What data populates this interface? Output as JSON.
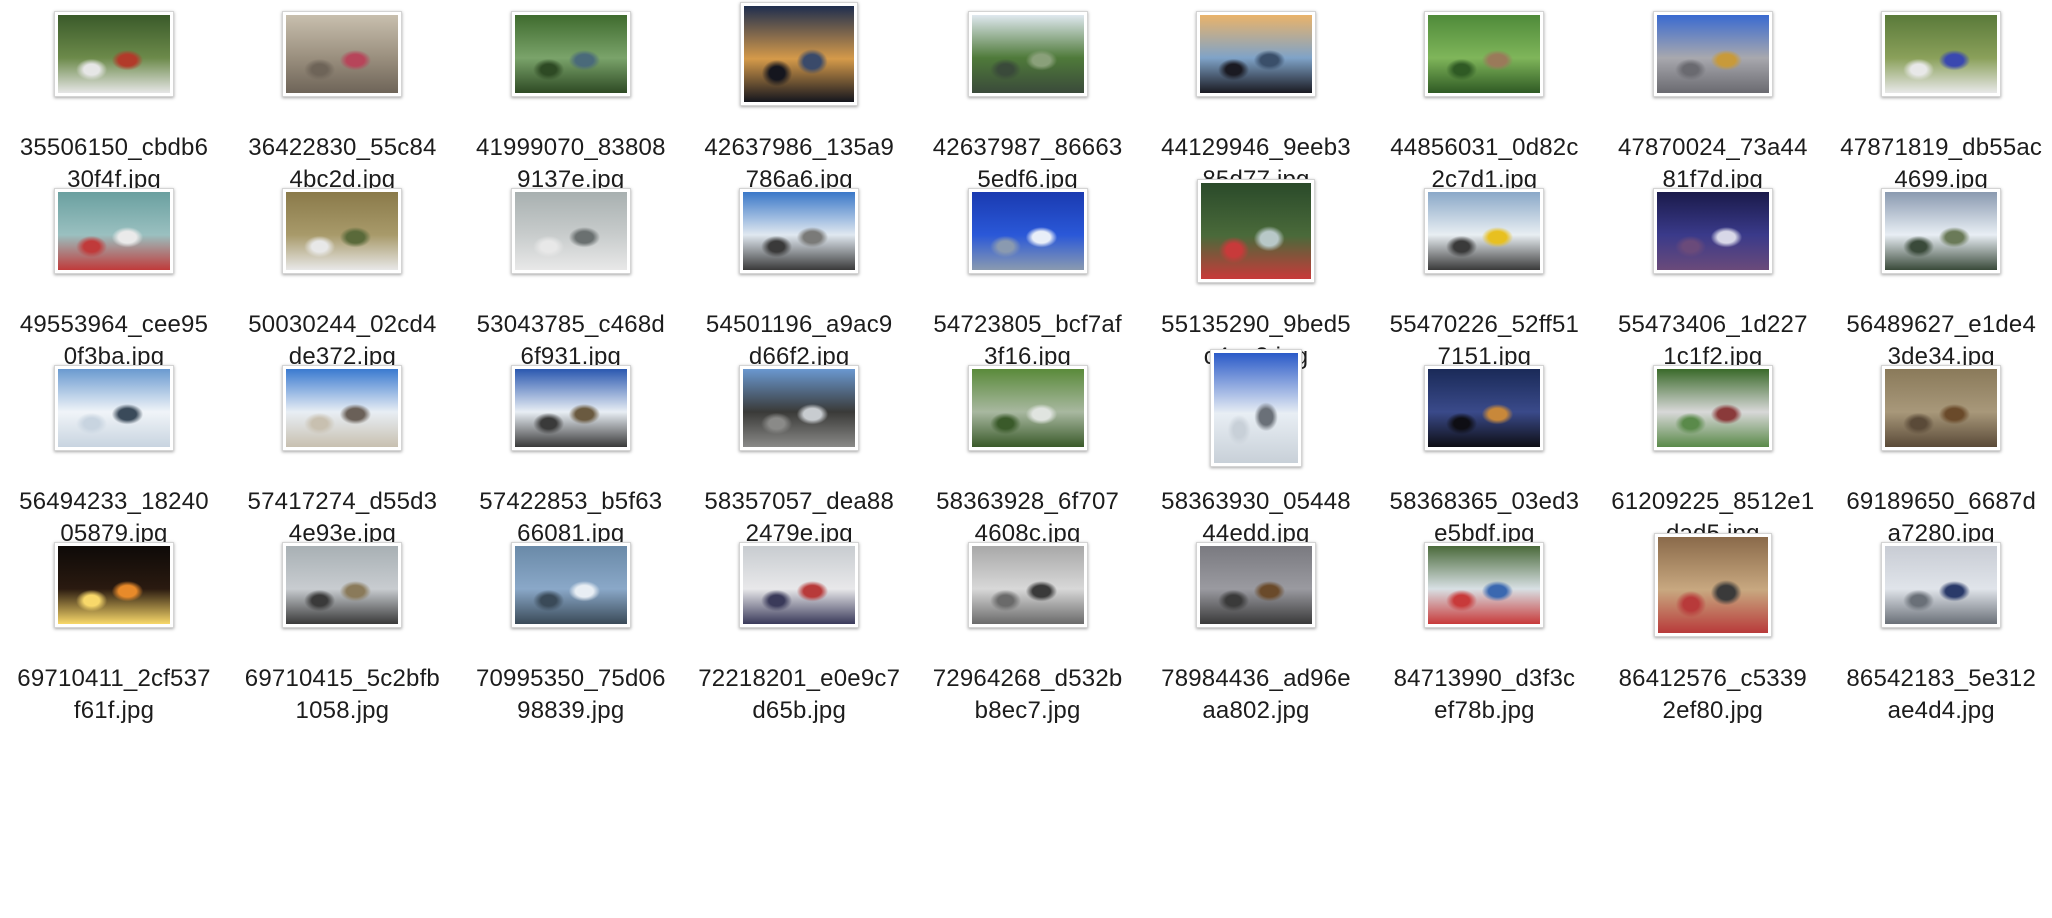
{
  "files": [
    {
      "line1": "35506150_cbdb6",
      "line2": "30f4f.jpg",
      "shape": "land",
      "colors": [
        "#3a5a2a",
        "#6c8a4a",
        "#b23a2a",
        "#e6e6e6"
      ]
    },
    {
      "line1": "36422830_55c84",
      "line2": "4bc2d.jpg",
      "shape": "land",
      "colors": [
        "#c8bfae",
        "#9a8f7e",
        "#b7455a",
        "#6e6458"
      ]
    },
    {
      "line1": "41999070_83808",
      "line2": "9137e.jpg",
      "shape": "land",
      "colors": [
        "#3f6b2e",
        "#7aa36a",
        "#4a6a7a",
        "#2e4a24"
      ]
    },
    {
      "line1": "42637986_135a9",
      "line2": "786a6.jpg",
      "shape": "tall",
      "colors": [
        "#1f2e4e",
        "#d59a4a",
        "#3a4a6a",
        "#15161e"
      ]
    },
    {
      "line1": "42637987_86663",
      "line2": "5edf6.jpg",
      "shape": "land",
      "colors": [
        "#dfe8ef",
        "#4f7a3a",
        "#8aa07a",
        "#3a4a3a"
      ]
    },
    {
      "line1": "44129946_9eeb3",
      "line2": "85d77.jpg",
      "shape": "land",
      "colors": [
        "#e9b36a",
        "#7fa3c8",
        "#3a4f6a",
        "#1a1a22"
      ]
    },
    {
      "line1": "44856031_0d82c",
      "line2": "2c7d1.jpg",
      "shape": "land",
      "colors": [
        "#4f8a3a",
        "#7fb55a",
        "#9a7a5a",
        "#2f5a24"
      ]
    },
    {
      "line1": "47870024_73a44",
      "line2": "81f7d.jpg",
      "shape": "land",
      "colors": [
        "#3a6ad0",
        "#a8a8ae",
        "#c89a3a",
        "#6a6a70"
      ]
    },
    {
      "line1": "47871819_db55ac",
      "line2": "4699.jpg",
      "shape": "land",
      "colors": [
        "#5a7a3a",
        "#8aa05a",
        "#3a48b0",
        "#e8e8e8"
      ]
    },
    {
      "line1": "49553964_cee95",
      "line2": "0f3ba.jpg",
      "shape": "land",
      "colors": [
        "#6aa0a0",
        "#9ac0c0",
        "#eaeaea",
        "#c03a3a"
      ]
    },
    {
      "line1": "50030244_02cd4",
      "line2": "de372.jpg",
      "shape": "land",
      "colors": [
        "#8a7a4a",
        "#a89a6a",
        "#5a6a3a",
        "#e8e8e8"
      ]
    },
    {
      "line1": "53043785_c468d",
      "line2": "6f931.jpg",
      "shape": "land",
      "colors": [
        "#a8b0b0",
        "#c8cccc",
        "#6a7070",
        "#e8e8e8"
      ]
    },
    {
      "line1": "54501196_a9ac9",
      "line2": "d66f2.jpg",
      "shape": "land",
      "colors": [
        "#3a78c8",
        "#e0e8f0",
        "#7a7a78",
        "#3a3a3a"
      ]
    },
    {
      "line1": "54723805_bcf7af",
      "line2": "3f16.jpg",
      "shape": "land",
      "colors": [
        "#1a3ab0",
        "#2a58d8",
        "#e8eef8",
        "#8a9ab0"
      ]
    },
    {
      "line1": "55135290_9bed5",
      "line2": "c4ca3.jpg",
      "shape": "tall",
      "colors": [
        "#2a4a2a",
        "#4a6a3a",
        "#b8c8c8",
        "#c83a3a"
      ]
    },
    {
      "line1": "55470226_52ff51",
      "line2": "7151.jpg",
      "shape": "land",
      "colors": [
        "#8aa8c8",
        "#e8eef2",
        "#e8c020",
        "#3a3a3a"
      ]
    },
    {
      "line1": "55473406_1d227",
      "line2": "1c1f2.jpg",
      "shape": "land",
      "colors": [
        "#1a1a4a",
        "#3a3a8a",
        "#d8d8e8",
        "#6a4a7a"
      ]
    },
    {
      "line1": "56489627_e1de4",
      "line2": "3de34.jpg",
      "shape": "land",
      "colors": [
        "#8a9ab0",
        "#e8eef4",
        "#6a7a58",
        "#3a4a3a"
      ]
    },
    {
      "line1": "56494233_18240",
      "line2": "05879.jpg",
      "shape": "land",
      "colors": [
        "#6a9ad0",
        "#f0f4f8",
        "#3a4a5a",
        "#c8d4e0"
      ]
    },
    {
      "line1": "57417274_d55d3",
      "line2": "4e93e.jpg",
      "shape": "land",
      "colors": [
        "#3a7ad0",
        "#e8eef4",
        "#6a6058",
        "#c8c0b0"
      ]
    },
    {
      "line1": "57422853_b5f63",
      "line2": "66081.jpg",
      "shape": "land",
      "colors": [
        "#2a58b0",
        "#e8eef4",
        "#6a5a40",
        "#3a3a3a"
      ]
    },
    {
      "line1": "58357057_dea88",
      "line2": "2479e.jpg",
      "shape": "land",
      "colors": [
        "#6a98d0",
        "#3a3a38",
        "#c8ccd0",
        "#8a8a88"
      ]
    },
    {
      "line1": "58363928_6f707",
      "line2": "4608c.jpg",
      "shape": "land",
      "colors": [
        "#5a8a3a",
        "#a8b8a0",
        "#e0e4e0",
        "#3a5a2a"
      ]
    },
    {
      "line1": "58363930_05448",
      "line2": "44edd.jpg",
      "shape": "port",
      "colors": [
        "#2a5ac8",
        "#e8eef4",
        "#6a7078",
        "#c8d0d8"
      ]
    },
    {
      "line1": "58368365_03ed3",
      "line2": "e5bdf.jpg",
      "shape": "land",
      "colors": [
        "#1a2a58",
        "#3a4a8a",
        "#c8883a",
        "#0e0e14"
      ]
    },
    {
      "line1": "61209225_8512e1",
      "line2": "dad5.jpg",
      "shape": "land",
      "colors": [
        "#3a6a2a",
        "#d8d8d8",
        "#8a3a3a",
        "#5a8a4a"
      ]
    },
    {
      "line1": "69189650_6687d",
      "line2": "a7280.jpg",
      "shape": "land",
      "colors": [
        "#8a7a5a",
        "#a8987a",
        "#6a4a2a",
        "#5a4a38"
      ]
    },
    {
      "line1": "69710411_2cf537",
      "line2": "f61f.jpg",
      "shape": "land",
      "colors": [
        "#0e0a08",
        "#2a1a10",
        "#e88a2a",
        "#f8d86a"
      ]
    },
    {
      "line1": "69710415_5c2bfb",
      "line2": "1058.jpg",
      "shape": "land",
      "colors": [
        "#a8b0b4",
        "#c8ccd0",
        "#8a7a5a",
        "#3a3a3a"
      ]
    },
    {
      "line1": "70995350_75d06",
      "line2": "98839.jpg",
      "shape": "land",
      "colors": [
        "#6a8aa8",
        "#8aa8c8",
        "#e8eef4",
        "#3a4a58"
      ]
    },
    {
      "line1": "72218201_e0e9c7",
      "line2": "d65b.jpg",
      "shape": "land",
      "colors": [
        "#c8ccd0",
        "#e8e8ea",
        "#b83a3a",
        "#3a3a5a"
      ]
    },
    {
      "line1": "72964268_d532b",
      "line2": "b8ec7.jpg",
      "shape": "land",
      "colors": [
        "#a8a8a8",
        "#d8d8d8",
        "#3a3a3a",
        "#6a6a6a"
      ]
    },
    {
      "line1": "78984436_ad96e",
      "line2": "aa802.jpg",
      "shape": "land",
      "colors": [
        "#7a7a80",
        "#9a9aa0",
        "#6a4a2a",
        "#3a3a3a"
      ]
    },
    {
      "line1": "84713990_d3f3c",
      "line2": "ef78b.jpg",
      "shape": "land",
      "colors": [
        "#4a6a3a",
        "#d8e0e4",
        "#3a68b0",
        "#c83a3a"
      ]
    },
    {
      "line1": "86412576_c5339",
      "line2": "2ef80.jpg",
      "shape": "tall",
      "colors": [
        "#8a6a4a",
        "#c8a880",
        "#3a3a3a",
        "#b83a3a"
      ]
    },
    {
      "line1": "86542183_5e312",
      "line2": "ae4d4.jpg",
      "shape": "land",
      "colors": [
        "#c8ccd4",
        "#e0e4ea",
        "#2a3a6a",
        "#6a7078"
      ]
    }
  ]
}
